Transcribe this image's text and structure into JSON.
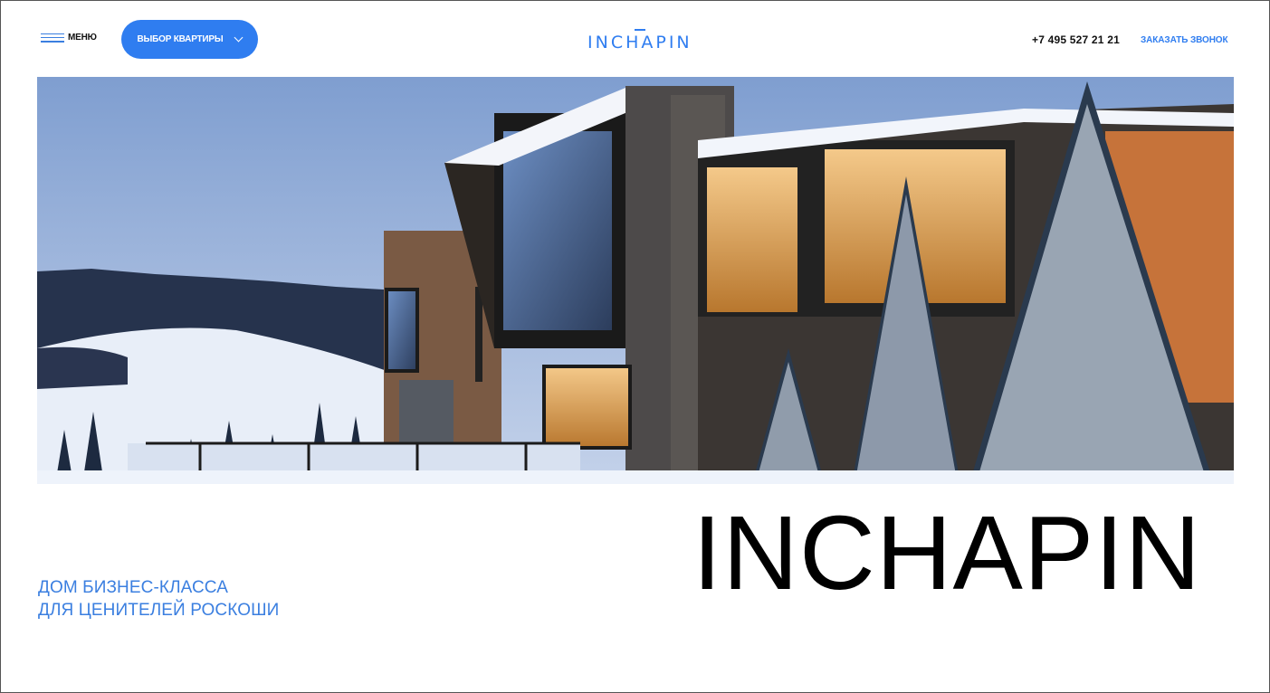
{
  "header": {
    "menu_label": "МЕНЮ",
    "select_label": "ВЫБОР КВАРТИРЫ",
    "logo_text": "INCHAPIN",
    "phone": "+7 495 527 21 21",
    "callback_label": "ЗАКАЗАТЬ ЗВОНОК"
  },
  "hero": {
    "image": "snowy-modern-house-photo"
  },
  "main": {
    "tagline_line1": "ДОМ БИЗНЕС-КЛАССА",
    "tagline_line2": "ДЛЯ ЦЕНИТЕЛЕЙ РОСКОШИ",
    "title": "INCHAPIN"
  },
  "colors": {
    "accent": "#2f7df0",
    "text": "#111111",
    "background": "#ffffff"
  }
}
